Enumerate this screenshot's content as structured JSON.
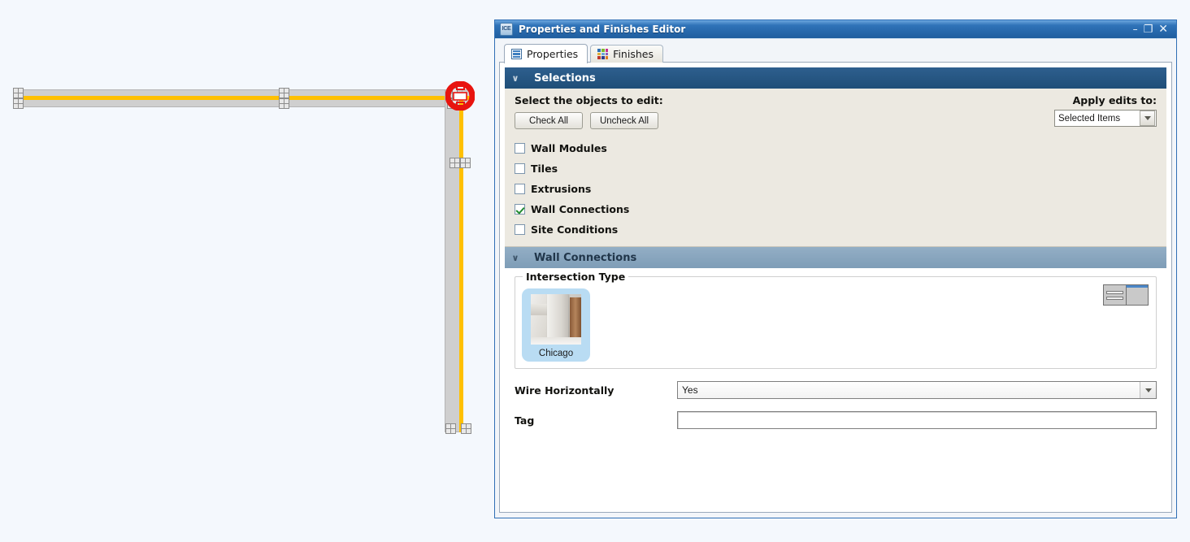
{
  "window": {
    "logo": "ICE",
    "logo_icon": "app-logo-icon",
    "title": "Properties and Finishes Editor",
    "minimize_label": "–",
    "maximize_label": "❐",
    "close_label": "✕"
  },
  "tabs": [
    {
      "label": "Properties",
      "icon": "list-icon",
      "active": true
    },
    {
      "label": "Finishes",
      "icon": "color-grid-icon",
      "active": false
    }
  ],
  "selections": {
    "header": "Selections",
    "chevron": "∨",
    "prompt": "Select the objects to edit:",
    "check_all_label": "Check All",
    "uncheck_all_label": "Uncheck All",
    "apply_label": "Apply edits to:",
    "apply_value": "Selected Items",
    "items": [
      {
        "label": "Wall Modules",
        "checked": false
      },
      {
        "label": "Tiles",
        "checked": false
      },
      {
        "label": "Extrusions",
        "checked": false
      },
      {
        "label": "Wall Connections",
        "checked": true
      },
      {
        "label": "Site Conditions",
        "checked": false
      }
    ]
  },
  "wall_connections": {
    "header": "Wall Connections",
    "chevron": "∨",
    "group_title": "Intersection Type",
    "swatches": [
      {
        "label": "Chicago",
        "selected": true
      }
    ],
    "view_modes": [
      {
        "name": "list-view",
        "selected": false
      },
      {
        "name": "thumbnail-view",
        "selected": true
      }
    ],
    "fields": [
      {
        "label": "Wire Horizontally",
        "type": "combo",
        "value": "Yes"
      },
      {
        "label": "Tag",
        "type": "text",
        "value": "",
        "placeholder": ""
      }
    ]
  },
  "canvas": {
    "name": "floor-plan-canvas",
    "walls": [
      {
        "name": "horizontal-wall",
        "orientation": "horizontal"
      },
      {
        "name": "vertical-wall",
        "orientation": "vertical"
      }
    ],
    "connection_marker": "wall-connection-marker"
  },
  "colors": {
    "title_bar": "#1f5d9f",
    "section_dark": "#1f4e78",
    "section_light": "#7e9db7",
    "selection_highlight": "#b9dcf3",
    "wall_fill": "#cfcfcf",
    "wall_centerline": "#ffc000",
    "marker_red": "#e8140f",
    "checkbox_check": "#1f8a2f",
    "canvas_background": "#f4f8fd"
  }
}
